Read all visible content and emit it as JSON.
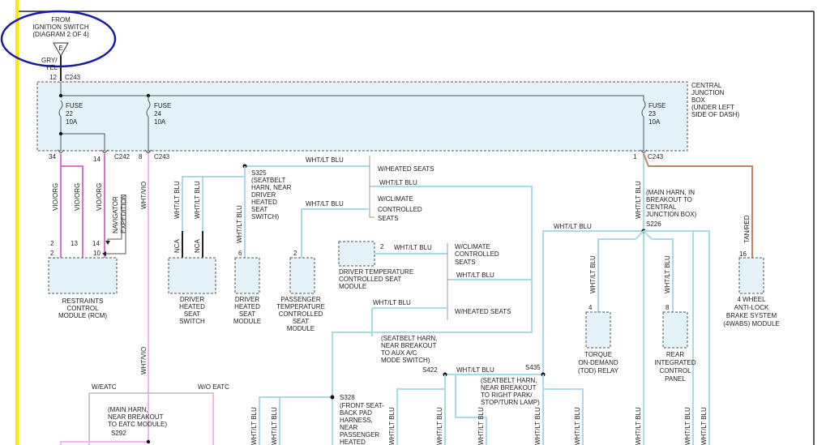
{
  "source": {
    "lines": [
      "FROM",
      "IGNITION SWITCH",
      "(DIAGRAM 2 OF 4)"
    ],
    "marker": "E",
    "wire": [
      "GRY/",
      "YEL"
    ]
  },
  "cjb": {
    "label": [
      "CENTRAL",
      "JUNCTION",
      "BOX",
      "(UNDER LEFT",
      "SIDE OF DASH)"
    ],
    "pin_in": "12",
    "conn_in": "C243",
    "fuses": [
      {
        "name": "FUSE",
        "num": "22",
        "amp": "10A"
      },
      {
        "name": "FUSE",
        "num": "24",
        "amp": "10A"
      },
      {
        "name": "FUSE",
        "num": "23",
        "amp": "10A"
      }
    ],
    "outs": [
      {
        "pin": "34",
        "conn": ""
      },
      {
        "pin": "14",
        "conn": "C242"
      },
      {
        "pin": "8",
        "conn": "C243"
      },
      {
        "pin": "1",
        "conn": "C243"
      }
    ]
  },
  "wires": {
    "vio_org": "VIO/ORG",
    "wht_vio": "WHT/VIO",
    "wht_ltblu": "WHT/LT BLU",
    "tan_red": "TAN/RED",
    "nca": "NCA",
    "navigator": "NAVIGATOR",
    "expedition": "EXPEDITION"
  },
  "options": {
    "heated": "W/HEATED SEATS",
    "climate": [
      "W/CLIMATE",
      "CONTROLLED",
      "SEATS"
    ],
    "eatc": "W/EATC",
    "no_eatc": "W/O EATC"
  },
  "splices": {
    "s325": [
      "S325",
      "(SEATBELT",
      "HARN, NEAR",
      "DRIVER",
      "HEATED",
      "SEAT",
      "SWITCH)"
    ],
    "s226": [
      "(MAIN HARN, IN",
      "BREAKOUT TO",
      "CENTRAL",
      "JUNCTION BOX)",
      "S226"
    ],
    "s422": [
      "(SEATBELT HARN,",
      "NEAR BREAKOUT",
      "TO AUX A/C",
      "MODE SWITCH)",
      "S422"
    ],
    "s435": [
      "S435",
      "(SEATBELT HARN,",
      "NEAR BREAKOUT",
      "TO RIGHT PARK/",
      "STOP/TURN LAMP)"
    ],
    "s328": [
      "S328",
      "(FRONT SEAT-",
      "BACK PAD",
      "HARNESS,",
      "NEAR",
      "PASSENGER",
      "HEATED"
    ],
    "s292": [
      "(MAIN HARN,",
      "NEAR BREAKOUT",
      "TO EATC MODULE)",
      "S292"
    ]
  },
  "components": {
    "rcm": {
      "label": [
        "RESTRAINTS",
        "CONTROL",
        "MODULE (RCM)"
      ],
      "pins": [
        "2",
        "13",
        "14",
        "2",
        "10"
      ]
    },
    "dhs_switch": {
      "label": [
        "DRIVER",
        "HEATED",
        "SEAT",
        "SWITCH"
      ]
    },
    "dhs_module": {
      "label": [
        "DRIVER",
        "HEATED",
        "SEAT",
        "MODULE"
      ],
      "pin": "6"
    },
    "ptcs": {
      "label": [
        "PASSENGER",
        "TEMPERATURE",
        "CONTROLLED",
        "SEAT",
        "MODULE"
      ],
      "pin": "2"
    },
    "dtcs": {
      "label": [
        "DRIVER TEMPERATURE",
        "CONTROLLED SEAT",
        "MODULE"
      ],
      "pin": "2"
    },
    "tod": {
      "label": [
        "TORQUE",
        "ON-DEMAND",
        "(TOD) RELAY"
      ],
      "pin": "4"
    },
    "ricp": {
      "label": [
        "REAR",
        "INTEGRATED",
        "CONTROL",
        "PANEL"
      ],
      "pin": "8"
    },
    "abs": {
      "label": [
        "4 WHEEL",
        "ANTI-LOCK",
        "BRAKE SYSTEM",
        "(4WABS) MODULE"
      ],
      "pin": "16"
    }
  }
}
